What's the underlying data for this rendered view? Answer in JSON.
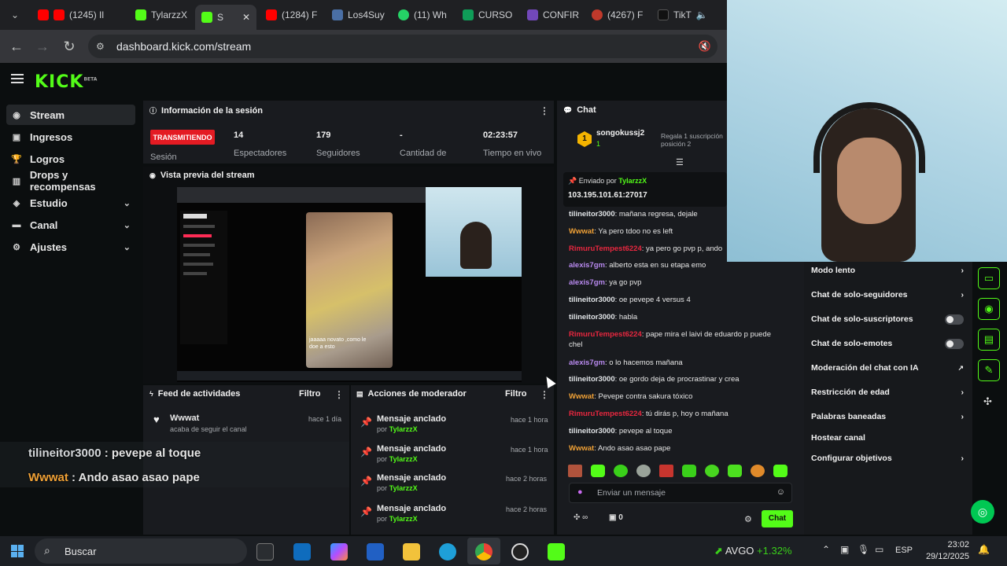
{
  "browser": {
    "tabs": [
      {
        "label": "(1245) Il",
        "fav": "#ff0000"
      },
      {
        "label": "TylarzzX",
        "fav": "#53fc18"
      },
      {
        "label": "S",
        "fav": "#53fc18"
      },
      {
        "label": "(1284) F",
        "fav": "#ff0000"
      },
      {
        "label": "Los4Suy",
        "fav": "#4a6fa5"
      },
      {
        "label": "(11) Wh",
        "fav": "#25d366"
      },
      {
        "label": "CURSO",
        "fav": "#0f9d58"
      },
      {
        "label": "CONFIR",
        "fav": "#7248b9"
      },
      {
        "label": "(4267) F",
        "fav": "#c0392b"
      },
      {
        "label": "TikT",
        "fav": "#111111"
      }
    ],
    "url": "dashboard.kick.com/stream"
  },
  "kick": {
    "logo": "KICK",
    "logo_beta": "BETA"
  },
  "sidebar": {
    "items": [
      {
        "label": "Stream",
        "icon": "broadcast-icon"
      },
      {
        "label": "Ingresos",
        "icon": "money-icon"
      },
      {
        "label": "Logros",
        "icon": "trophy-icon"
      },
      {
        "label": "Drops y recompensas",
        "icon": "gift-icon"
      },
      {
        "label": "Estudio",
        "icon": "studio-icon"
      },
      {
        "label": "Canal",
        "icon": "channel-icon"
      },
      {
        "label": "Ajustes",
        "icon": "gear-icon"
      }
    ]
  },
  "session": {
    "title": "Información de la sesión",
    "live_badge": "TRANSMITIENDO",
    "session_label": "Sesión",
    "stats": [
      {
        "value": "14",
        "label": "Espectadores"
      },
      {
        "value": "179",
        "label": "Seguidores"
      },
      {
        "value": "-",
        "label": "Cantidad de"
      },
      {
        "value": "02:23:57",
        "label": "Tiempo en vivo"
      }
    ]
  },
  "preview": {
    "title": "Vista previa del stream",
    "inner_caption": "jaaaaa novato ,como le doe a esto"
  },
  "feed": {
    "title": "Feed de actividades",
    "filter": "Filtro",
    "items": [
      {
        "user": "Wwwat",
        "text": "acaba de seguir el canal",
        "time": "hace 1 día"
      }
    ]
  },
  "mod": {
    "title": "Acciones de moderador",
    "filter": "Filtro",
    "items": [
      {
        "action": "Mensaje anclado",
        "by": "por",
        "user": "TylarzzX",
        "time": "hace 1 hora"
      },
      {
        "action": "Mensaje anclado",
        "by": "por",
        "user": "TylarzzX",
        "time": "hace 1 hora"
      },
      {
        "action": "Mensaje anclado",
        "by": "por",
        "user": "TylarzzX",
        "time": "hace 2 horas"
      },
      {
        "action": "Mensaje anclado",
        "by": "por",
        "user": "TylarzzX",
        "time": "hace 2 horas"
      }
    ]
  },
  "chat": {
    "title": "Chat",
    "top_gifter": {
      "rank": "1",
      "user": "songokussj2",
      "count": "1",
      "note": "Regala 1 suscripción",
      "note2": "posición 2"
    },
    "pinned": {
      "label": "Enviado por",
      "user": "TylarzzX",
      "text": "103.195.101.61:27017"
    },
    "messages": [
      {
        "user": "tilineitor3000",
        "text": "mañana regresa, dejale",
        "color": "grey"
      },
      {
        "user": "Wwwat",
        "text": "Ya pero tdoo no es left",
        "color": "orange"
      },
      {
        "user": "RimuruTempest6224",
        "text": "ya pero go pvp p, ando",
        "color": "red"
      },
      {
        "user": "alexis7gm",
        "text": "alberto esta en su etapa emo",
        "color": "purple"
      },
      {
        "user": "alexis7gm",
        "text": "ya go pvp",
        "color": "purple"
      },
      {
        "user": "tilineitor3000",
        "text": "oe pevepe 4 versus 4",
        "color": "grey"
      },
      {
        "user": "tilineitor3000",
        "text": "habla",
        "color": "grey"
      },
      {
        "user": "RimuruTempest6224",
        "text": "pape mira el laivi de eduardo p puede chel",
        "color": "red"
      },
      {
        "user": "alexis7gm",
        "text": "o lo hacemos mañana",
        "color": "purple"
      },
      {
        "user": "tilineitor3000",
        "text": "oe gordo deja de procrastinar y crea",
        "color": "grey"
      },
      {
        "user": "Wwwat",
        "text": "Pevepe contra sakura tóxico",
        "color": "orange"
      },
      {
        "user": "RimuruTempest6224",
        "text": "tú dirás p, hoy o mañana",
        "color": "red"
      },
      {
        "user": "tilineitor3000",
        "text": "pevepe al toque",
        "color": "grey"
      },
      {
        "user": "Wwwat",
        "text": "Ando asao asao pape",
        "color": "orange"
      }
    ],
    "input_placeholder": "Enviar un mensaje",
    "points": "0",
    "send_label": "Chat"
  },
  "settings_menu": {
    "items": [
      {
        "label": "Modo lento",
        "control": "chevron"
      },
      {
        "label": "Chat de solo-seguidores",
        "control": "chevron"
      },
      {
        "label": "Chat de solo-suscriptores",
        "control": "toggle"
      },
      {
        "label": "Chat de solo-emotes",
        "control": "toggle"
      },
      {
        "label": "Moderación del chat con IA",
        "control": "external"
      },
      {
        "label": "Restricción de edad",
        "control": "chevron"
      },
      {
        "label": "Palabras baneadas",
        "control": "chevron"
      },
      {
        "label": "Hostear canal",
        "control": "none"
      },
      {
        "label": "Configurar objetivos",
        "control": "chevron"
      }
    ]
  },
  "overlay": {
    "lines": [
      {
        "user": "tilineitor3000",
        "text": ": pevepe al toque"
      },
      {
        "user": "Wwwat",
        "text": ": Ando asao asao pape"
      }
    ]
  },
  "taskbar": {
    "search": "Buscar",
    "stock": {
      "name": "AVGO",
      "change": "+1.32%"
    },
    "lang": "ESP",
    "time": "23:02",
    "date": "29/12/2025"
  },
  "colors": {
    "kick_green": "#53fc18",
    "live_red": "#e41b23",
    "panel": "#191b1f",
    "bg": "#0b0e0f"
  }
}
